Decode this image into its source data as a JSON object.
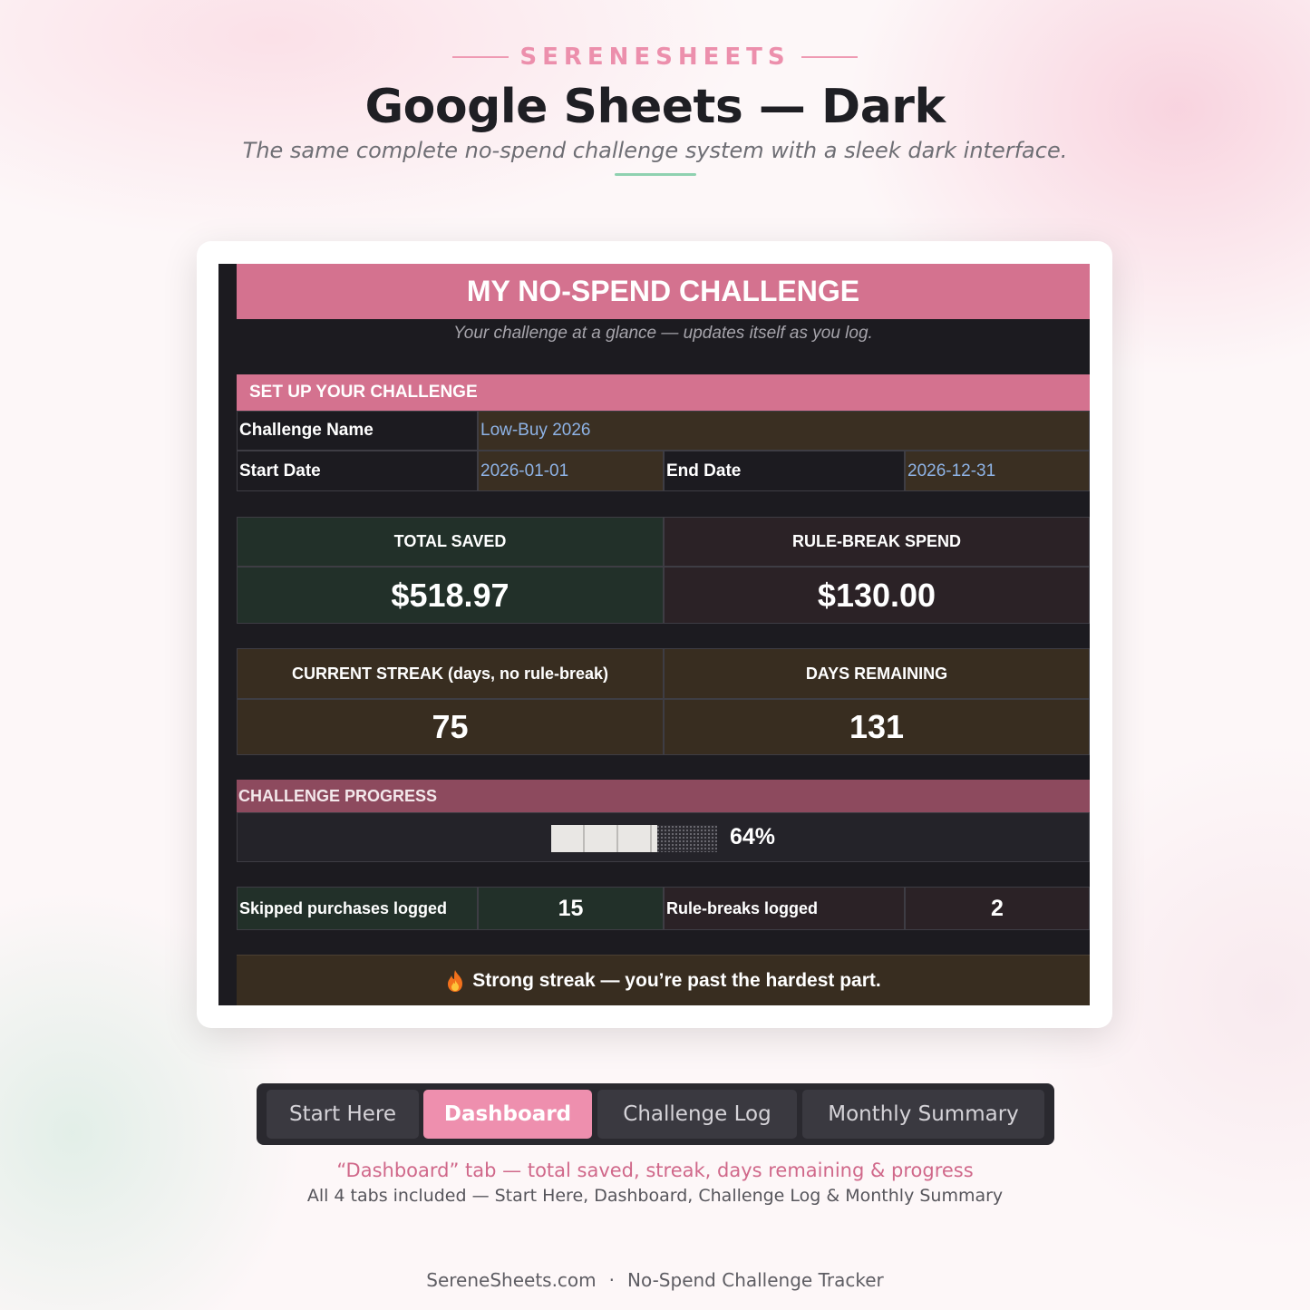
{
  "header": {
    "brand": "SERENESHEETS",
    "title": "Google Sheets — Dark",
    "subtitle": "The same complete no-spend challenge system with a sleek dark interface."
  },
  "sheet": {
    "title": "MY NO-SPEND CHALLENGE",
    "tagline": "Your challenge at a glance — updates itself as you log.",
    "setup": {
      "header": "SET UP YOUR CHALLENGE",
      "challenge_name_label": "Challenge Name",
      "challenge_name_value": "Low-Buy 2026",
      "start_date_label": "Start Date",
      "start_date_value": "2026-01-01",
      "end_date_label": "End Date",
      "end_date_value": "2026-12-31"
    },
    "kpis": {
      "total_saved_label": "TOTAL SAVED",
      "total_saved_value": "$518.97",
      "rule_break_label": "RULE-BREAK SPEND",
      "rule_break_value": "$130.00",
      "streak_label": "CURRENT STREAK (days, no rule-break)",
      "streak_value": "75",
      "days_remaining_label": "DAYS REMAINING",
      "days_remaining_value": "131"
    },
    "progress": {
      "header": "CHALLENGE PROGRESS",
      "percent_text": "64%",
      "fraction": 0.64
    },
    "stats": {
      "skipped_label": "Skipped purchases logged",
      "skipped_value": "15",
      "rule_breaks_label": "Rule-breaks logged",
      "rule_breaks_value": "2"
    },
    "message": "Strong streak — you’re past the hardest part.",
    "message_icon": "flame-icon"
  },
  "tabs": [
    {
      "label": "Start Here",
      "active": false
    },
    {
      "label": "Dashboard",
      "active": true
    },
    {
      "label": "Challenge Log",
      "active": false
    },
    {
      "label": "Monthly Summary",
      "active": false
    }
  ],
  "captions": {
    "line1": "“Dashboard” tab — total saved, streak, days remaining & progress",
    "line2": "All 4 tabs included — Start Here, Dashboard, Challenge Log & Monthly Summary"
  },
  "footer": {
    "site": "SereneSheets.com",
    "separator": "·",
    "product": "No-Spend Challenge Tracker"
  },
  "colors": {
    "accent_pink": "#d4728f",
    "tab_active": "#ee8fae",
    "sheet_bg": "#1c1b20",
    "saved_green": "#223029",
    "input_brown": "#3a2f22",
    "input_text": "#8eb3e6"
  }
}
